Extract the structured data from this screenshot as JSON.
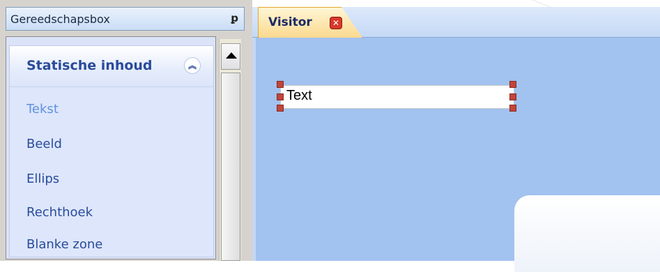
{
  "toolbox": {
    "title": "Gereedschapsbox",
    "pin_icon": "pin-icon",
    "group": {
      "title": "Statische inhoud",
      "collapse_icon": "chevron-double-up-icon",
      "items": [
        {
          "label": "Tekst",
          "selected": true
        },
        {
          "label": "Beeld",
          "selected": false
        },
        {
          "label": "Ellips",
          "selected": false
        },
        {
          "label": "Rechthoek",
          "selected": false
        },
        {
          "label": "Blanke zone",
          "selected": false
        }
      ]
    }
  },
  "designer": {
    "tab": {
      "label": "Visitor",
      "close_icon": "close-icon"
    },
    "text_element": {
      "label": "Text"
    }
  },
  "colors": {
    "canvas": "#a2c2ef",
    "tab_active": "#fbd98e",
    "group_title": "#2a4b9b",
    "selected_item": "#5f92df"
  }
}
